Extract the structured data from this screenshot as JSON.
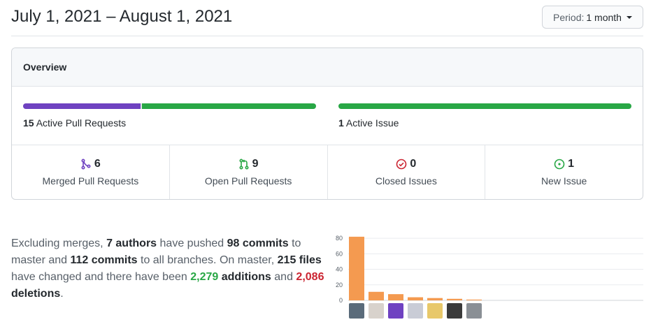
{
  "header": {
    "date_range": "July 1, 2021 – August 1, 2021",
    "period_label": "Period:",
    "period_value": "1 month"
  },
  "overview": {
    "title": "Overview",
    "pull_requests": {
      "count": "15",
      "label": "Active Pull Requests",
      "merged_fraction": 0.4
    },
    "issues": {
      "count": "1",
      "label": "Active Issue",
      "fraction": 1.0
    },
    "stats": [
      {
        "value": "6",
        "label": "Merged Pull Requests",
        "icon": "merge-icon",
        "color": "#6f42c1"
      },
      {
        "value": "9",
        "label": "Open Pull Requests",
        "icon": "pull-request-icon",
        "color": "#28a745"
      },
      {
        "value": "0",
        "label": "Closed Issues",
        "icon": "issue-closed-icon",
        "color": "#cb2431"
      },
      {
        "value": "1",
        "label": "New Issue",
        "icon": "issue-opened-icon",
        "color": "#28a745"
      }
    ]
  },
  "summary": {
    "t1": "Excluding merges, ",
    "authors": "7 authors",
    "t2": " have pushed ",
    "commits_master": "98 commits",
    "t3": " to master and ",
    "commits_all": "112 commits",
    "t4": " to all branches. On master, ",
    "files": "215 files",
    "t5": " have changed and there have been ",
    "additions_num": "2,279",
    "additions_word": " additions",
    "t6": " and ",
    "deletions_num": "2,086",
    "deletions_word": " deletions",
    "t7": "."
  },
  "chart_data": {
    "type": "bar",
    "categories": [
      "author-1",
      "author-2",
      "author-3",
      "author-4",
      "author-5",
      "author-6",
      "author-7"
    ],
    "values": [
      82,
      11,
      8,
      4,
      3,
      2,
      1
    ],
    "ylim": [
      0,
      90
    ],
    "yticks": [
      0,
      20,
      40,
      60,
      80
    ],
    "grid": true,
    "bar_color": "#f49a50",
    "xlabel": "",
    "ylabel": ""
  }
}
